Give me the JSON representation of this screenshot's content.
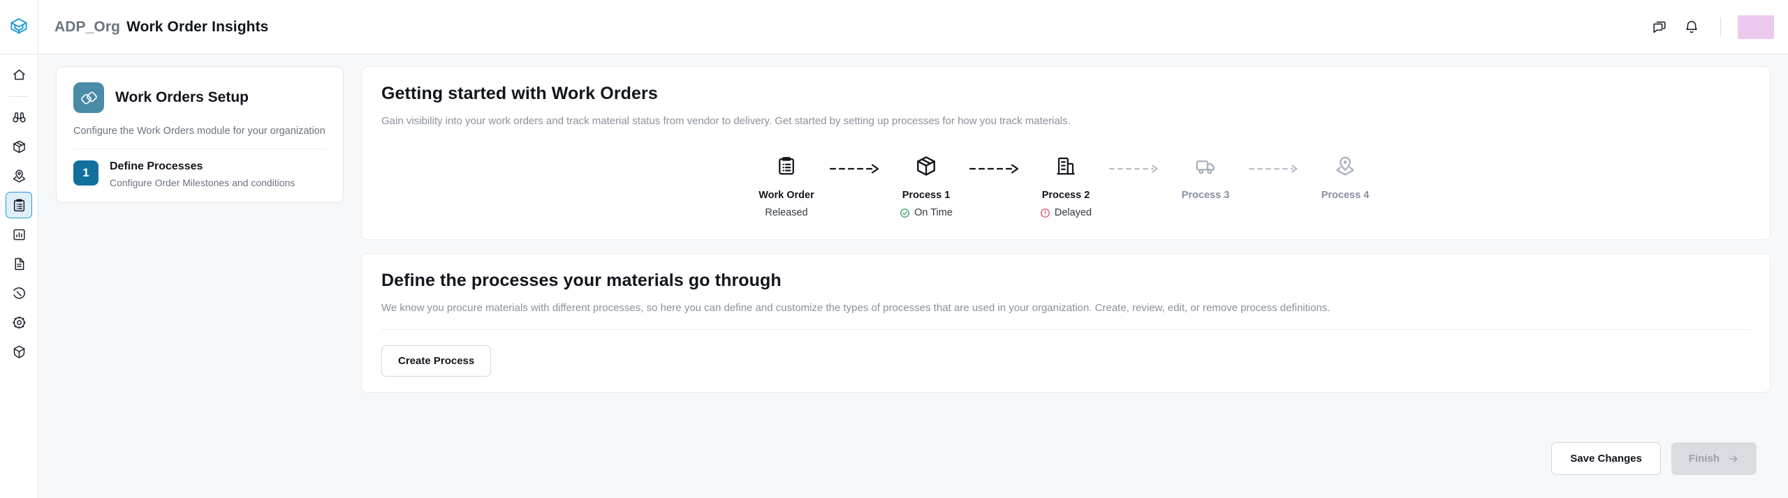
{
  "topbar": {
    "org": "ADP_Org",
    "title": "Work Order Insights",
    "icons": {
      "chat": "chat-bubbles-icon",
      "bell": "notification-bell-icon"
    }
  },
  "rail": {
    "items": [
      {
        "name": "home",
        "icon": "home-icon",
        "active": false
      },
      {
        "name": "insights",
        "icon": "binoculars-icon",
        "active": false
      },
      {
        "name": "shipments",
        "icon": "package-box-icon",
        "active": false
      },
      {
        "name": "tracking",
        "icon": "location-pin-icon",
        "active": false
      },
      {
        "name": "work-orders",
        "icon": "clipboard-list-icon",
        "active": true
      },
      {
        "name": "reports",
        "icon": "bar-chart-icon",
        "active": false
      },
      {
        "name": "documents",
        "icon": "document-icon",
        "active": false
      },
      {
        "name": "labels",
        "icon": "tag-icon",
        "active": false
      },
      {
        "name": "settings",
        "icon": "gear-icon",
        "active": false
      },
      {
        "name": "admin",
        "icon": "shield-icon",
        "active": false
      }
    ]
  },
  "setup_card": {
    "title": "Work Orders Setup",
    "icon": "diamond-links-icon",
    "subtitle": "Configure the Work Orders module for your organization",
    "steps": [
      {
        "number": "1",
        "title": "Define Processes",
        "subtitle": "Configure Order Milestones and conditions"
      }
    ]
  },
  "getting_started": {
    "title": "Getting started with Work Orders",
    "description": "Gain visibility into your work orders and track material status from vendor to delivery. Get started by setting up processes for how you track materials.",
    "flow": [
      {
        "label": "Work Order",
        "status": "Released",
        "status_icon": "none",
        "icon": "clipboard-list-icon",
        "muted": false
      },
      {
        "label": "Process 1",
        "status": "On Time",
        "status_icon": "check-circle-icon",
        "icon": "package-box-icon",
        "muted": false
      },
      {
        "label": "Process 2",
        "status": "Delayed",
        "status_icon": "alert-circle-icon",
        "icon": "building-icon",
        "muted": false
      },
      {
        "label": "Process 3",
        "status": "",
        "status_icon": "none",
        "icon": "truck-icon",
        "muted": true
      },
      {
        "label": "Process 4",
        "status": "",
        "status_icon": "none",
        "icon": "location-pin-icon",
        "muted": true
      }
    ],
    "arrow_icon": "dashed-arrow-right-icon"
  },
  "define_processes": {
    "title": "Define the processes your materials go through",
    "description": "We know you procure materials with different processes, so here you can define and customize the types of processes that are used in your organization. Create, review, edit, or remove process definitions.",
    "create_button": "Create Process"
  },
  "footer": {
    "save_label": "Save Changes",
    "finish_label": "Finish",
    "finish_icon": "arrow-right-icon"
  },
  "colors": {
    "accent_blue": "#12709e",
    "active_rail": "#1c9ad6",
    "badge_teal": "#4a8ba8",
    "success_green": "#2e9e5b",
    "danger_red": "#e0515e",
    "muted_gray": "#8791a0",
    "avatar": "#eec9ef"
  }
}
